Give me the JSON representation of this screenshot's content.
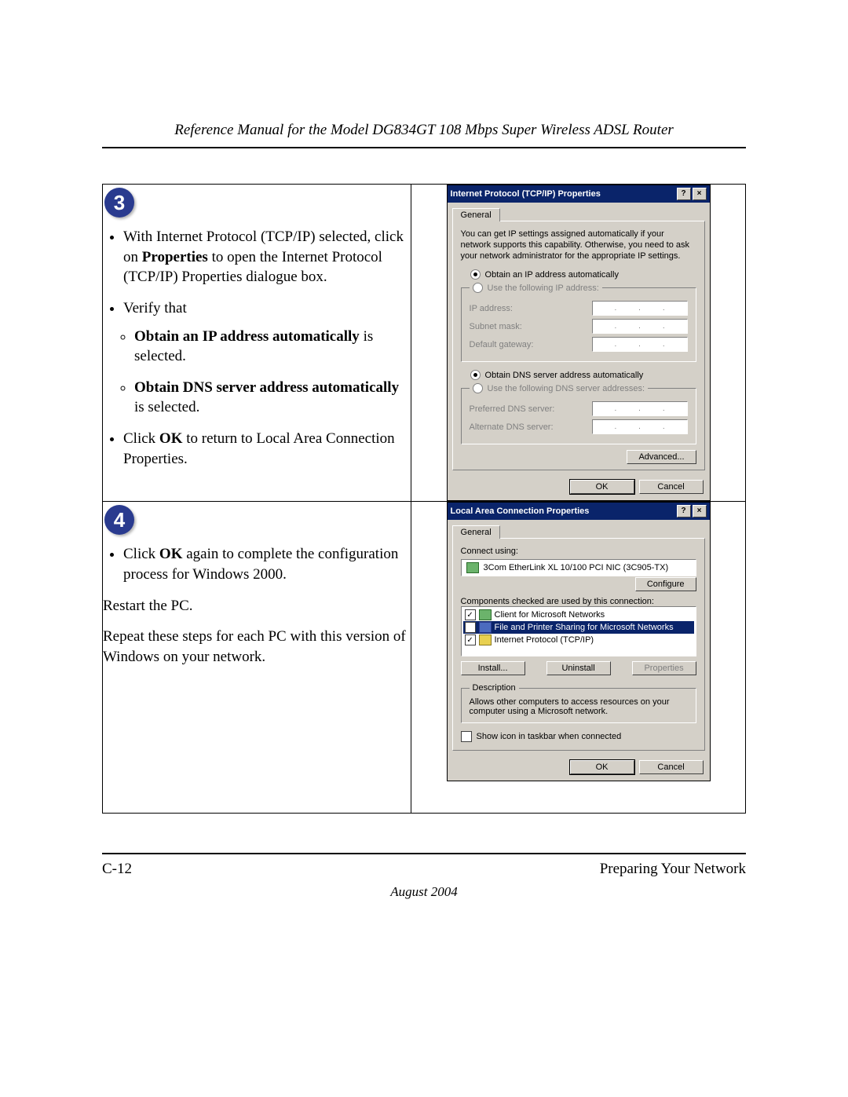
{
  "header": {
    "running_title": "Reference Manual for the Model DG834GT 108 Mbps Super Wireless ADSL Router"
  },
  "step3": {
    "number": "3",
    "bullets": {
      "b1_pre": "With Internet Protocol (TCP/IP) selected, click on ",
      "b1_bold": "Properties",
      "b1_post": " to open the Internet Protocol (TCP/IP) Properties dialogue box.",
      "b2": "Verify that",
      "b2a_bold": "Obtain an IP address automatically",
      "b2a_post": " is selected.",
      "b2b_bold": "Obtain DNS server address automatically",
      "b2b_post": " is selected.",
      "b3_pre": "Click ",
      "b3_bold": "OK",
      "b3_post": " to return to Local Area Connection Properties."
    }
  },
  "step4": {
    "number": "4",
    "b1_pre": "Click ",
    "b1_bold": "OK",
    "b1_post": " again to complete the configuration process for Windows 2000.",
    "p1": "Restart the PC.",
    "p2": "Repeat these steps for each PC with this version of Windows on your network."
  },
  "tcpip_dialog": {
    "title": "Internet Protocol (TCP/IP) Properties",
    "tab": "General",
    "intro": "You can get IP settings assigned automatically if your network supports this capability. Otherwise, you need to ask your network administrator for the appropriate IP settings.",
    "r_auto_ip": "Obtain an IP address automatically",
    "r_use_ip": "Use the following IP address:",
    "ip_address": "IP address:",
    "subnet": "Subnet mask:",
    "gateway": "Default gateway:",
    "r_auto_dns": "Obtain DNS server address automatically",
    "r_use_dns": "Use the following DNS server addresses:",
    "pref_dns": "Preferred DNS server:",
    "alt_dns": "Alternate DNS server:",
    "advanced": "Advanced...",
    "ok": "OK",
    "cancel": "Cancel"
  },
  "lac_dialog": {
    "title": "Local Area Connection Properties",
    "tab": "General",
    "connect_using": "Connect using:",
    "nic": "3Com EtherLink XL 10/100 PCI NIC (3C905-TX)",
    "configure": "Configure",
    "components_label": "Components checked are used by this connection:",
    "components": [
      {
        "label": "Client for Microsoft Networks",
        "checked": true,
        "selected": false,
        "icon": "green"
      },
      {
        "label": "File and Printer Sharing for Microsoft Networks",
        "checked": false,
        "selected": true,
        "icon": "blue"
      },
      {
        "label": "Internet Protocol (TCP/IP)",
        "checked": true,
        "selected": false,
        "icon": "net"
      }
    ],
    "install": "Install...",
    "uninstall": "Uninstall",
    "properties": "Properties",
    "desc_legend": "Description",
    "desc_text": "Allows other computers to access resources on your computer using a Microsoft network.",
    "show_icon": "Show icon in taskbar when connected",
    "ok": "OK",
    "cancel": "Cancel"
  },
  "footer": {
    "page_num": "C-12",
    "section": "Preparing Your Network",
    "date": "August 2004"
  }
}
